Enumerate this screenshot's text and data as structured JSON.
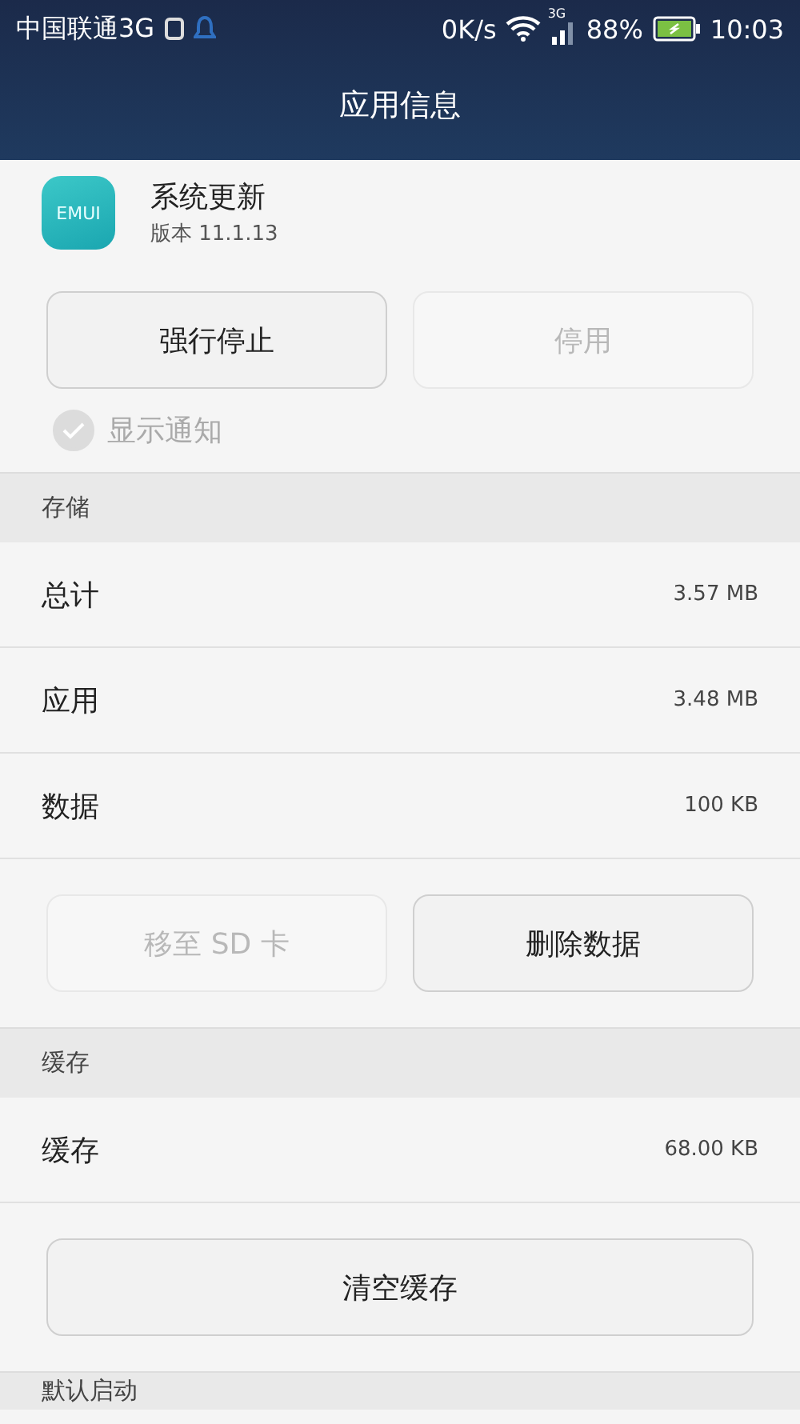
{
  "status_bar": {
    "carrier": "中国联通3G",
    "speed": "0K/s",
    "network": "3G",
    "battery": "88%",
    "time": "10:03"
  },
  "title_bar": {
    "title": "应用信息"
  },
  "app": {
    "icon_text": "EMUI",
    "name": "系统更新",
    "version": "版本 11.1.13"
  },
  "actions": [
    {
      "label": "强行停止",
      "disabled": false
    },
    {
      "label": "停用",
      "disabled": true
    }
  ],
  "notification": {
    "label": "显示通知",
    "checked": true,
    "disabled": true
  },
  "sections": [
    {
      "title": "存储",
      "rows": [
        {
          "label": "总计",
          "value": "3.57 MB"
        },
        {
          "label": "应用",
          "value": "3.48 MB"
        },
        {
          "label": "数据",
          "value": "100 KB"
        }
      ],
      "buttons": [
        {
          "label": "移至 SD 卡",
          "disabled": true
        },
        {
          "label": "删除数据",
          "disabled": false
        }
      ]
    },
    {
      "title": "缓存",
      "rows": [
        {
          "label": "缓存",
          "value": "68.00 KB"
        }
      ],
      "buttons": [
        {
          "label": "清空缓存",
          "disabled": false
        }
      ]
    },
    {
      "title": "默认启动"
    }
  ]
}
